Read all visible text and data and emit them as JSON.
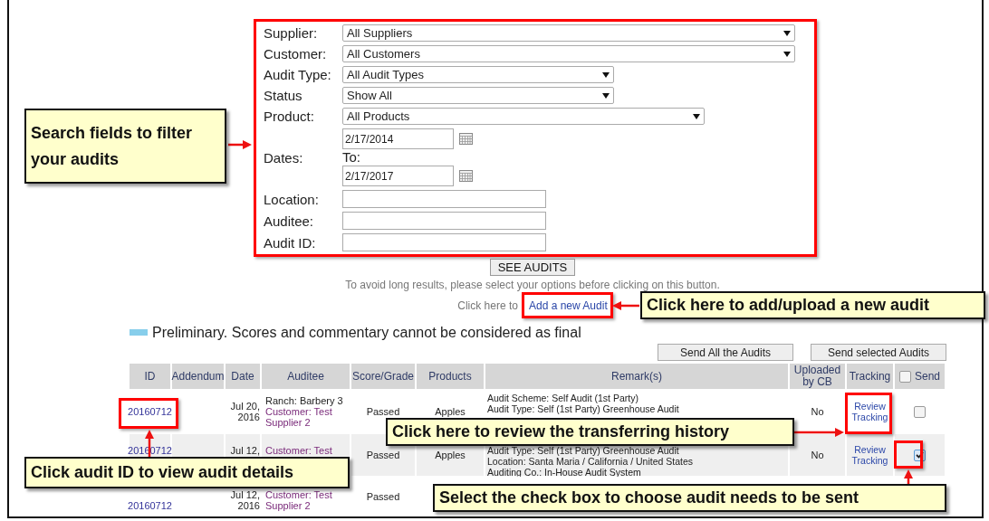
{
  "filters": [
    {
      "kind": "select",
      "label": "Supplier:",
      "value": "All Suppliers"
    },
    {
      "kind": "select",
      "label": "Customer:",
      "value": "All Customers"
    },
    {
      "kind": "select",
      "label": "Audit Type:",
      "value": "All Audit Types"
    },
    {
      "kind": "select",
      "label": "Status",
      "value": "Show All"
    },
    {
      "kind": "select",
      "label": "Product:",
      "value": "All Products"
    },
    {
      "kind": "daterange",
      "label": "Dates:",
      "from": "2/17/2014",
      "to_label": "To:",
      "to": "2/17/2017"
    },
    {
      "kind": "text",
      "label": "Location:"
    },
    {
      "kind": "text",
      "label": "Auditee:"
    },
    {
      "kind": "text",
      "label": "Audit ID:"
    }
  ],
  "see_audits_button": "SEE AUDITS",
  "hint": "To avoid long results, please select your options before clicking on this button.",
  "add_audit": {
    "prefix": "Click here to",
    "link": "Add a new Audit"
  },
  "legend": "Preliminary. Scores and commentary cannot be considered as final",
  "actions": [
    "Send All the Audits",
    "Send selected Audits"
  ],
  "table": {
    "columns": [
      "ID",
      "Addendum",
      "Date",
      "Auditee",
      "Score/Grade",
      "Products",
      "Remark(s)",
      "Uploaded by CB",
      "Tracking",
      "Send"
    ],
    "send_all_checked": false,
    "rows": [
      {
        "id": "20160712",
        "date": "Jul 20, 2016",
        "auditee_ranch": "Ranch: Barbery 3",
        "auditee_customer": "Customer: Test Supplier 2",
        "score": "Passed",
        "products": "Apples",
        "remarks": [
          "Audit Scheme: Self Audit (1st Party)",
          "Audit Type: Self (1st Party) Greenhouse Audit"
        ],
        "uploaded": "No",
        "tracking": "Review Tracking",
        "send_checked": false
      },
      {
        "id": "20160712",
        "date": "Jul 12,",
        "auditee_customer": "Customer: Test",
        "score": "Passed",
        "products": "Apples",
        "remarks": [
          "Audit Type: Self (1st Party) Greenhouse Audit",
          "Location: Santa Maria / California / United States",
          "Auditing Co.: In-House Audit System"
        ],
        "uploaded": "No",
        "tracking": "Review Tracking",
        "send_checked": true
      },
      {
        "id": "20160712",
        "date": "Jul 12, 2016",
        "auditee_customer": "Customer: Test Supplier 2",
        "score": "Passed"
      }
    ]
  },
  "callouts": [
    "Search fields to filter your audits",
    "Click here to add/upload a new audit",
    "Click here to review the transferring history",
    "Click audit ID to view audit details",
    "Select the check box to choose audit needs to be sent"
  ]
}
